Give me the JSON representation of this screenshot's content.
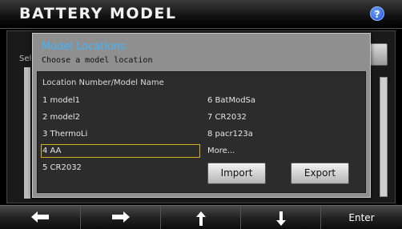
{
  "app": {
    "title": "BATTERY MODEL",
    "help_icon": "question-circle-icon"
  },
  "background": {
    "select_label": "Sele"
  },
  "modal": {
    "title": "Model Locations",
    "subtitle": "Choose a model location",
    "list_header": "Location Number/Model Name",
    "locations_left": [
      {
        "label": "1 model1"
      },
      {
        "label": "2 model2"
      },
      {
        "label": "3 ThermoLi"
      },
      {
        "label": "4 AA",
        "selected": true
      },
      {
        "label": "5 CR2032"
      }
    ],
    "locations_right": [
      {
        "label": "6 BatModSa"
      },
      {
        "label": "7 CR2032"
      },
      {
        "label": "8 pacr123a"
      },
      {
        "label": "More..."
      }
    ],
    "import_label": "Import",
    "export_label": "Export"
  },
  "bottom_nav": {
    "left_icon": "arrow-left-icon",
    "right_icon": "arrow-right-icon",
    "up_icon": "arrow-up-icon",
    "down_icon": "arrow-down-icon",
    "enter_label": "Enter"
  },
  "colors": {
    "accent_title": "#3fb6ff",
    "selection_outline": "#d7b21a"
  }
}
